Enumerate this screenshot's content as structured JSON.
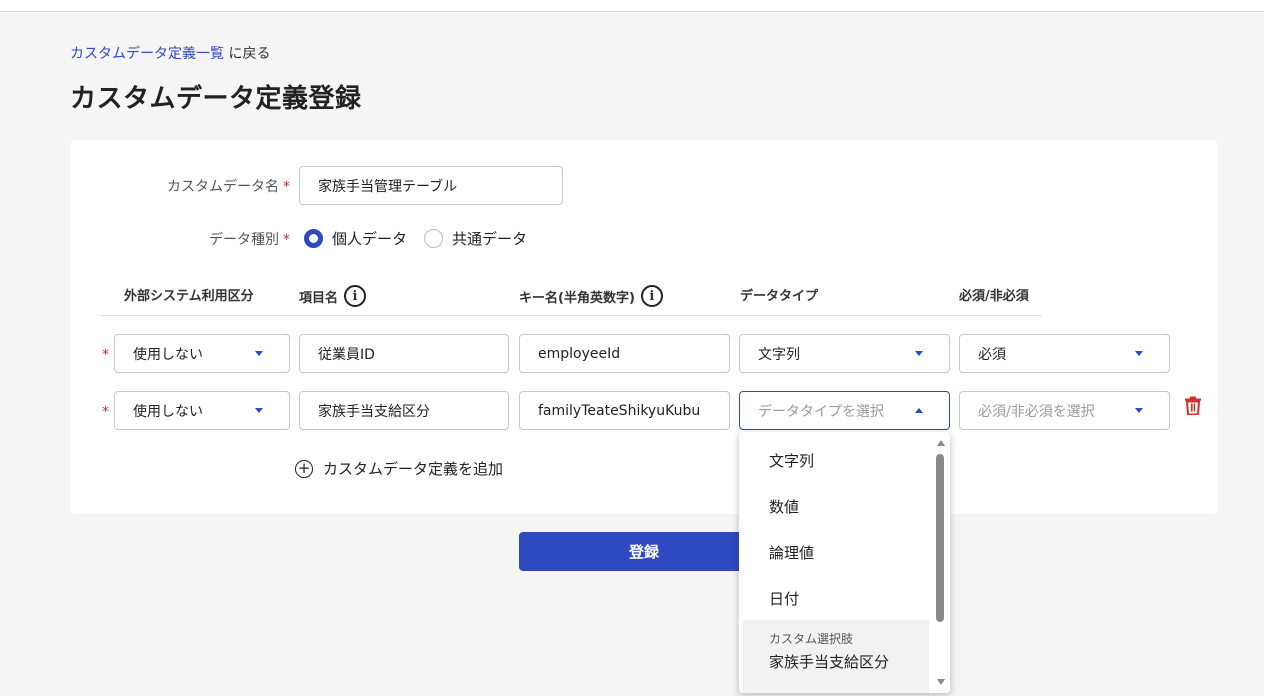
{
  "breadcrumb": {
    "link": "カスタムデータ定義一覧",
    "rest": " に戻る"
  },
  "page_title": "カスタムデータ定義登録",
  "form": {
    "name_label": "カスタムデータ名",
    "name_value": "家族手当管理テーブル",
    "type_label": "データ種別",
    "required_mark": "*",
    "radio_personal": "個人データ",
    "radio_shared": "共通データ",
    "radio_selected": "personal"
  },
  "columns": {
    "external": "外部システム利用区分",
    "item_name": "項目名",
    "key_name": "キー名(半角英数字)",
    "data_type": "データタイプ",
    "required": "必須/非必須",
    "info_glyph": "i"
  },
  "rows": [
    {
      "req": "*",
      "external": "使用しない",
      "item_name": "従業員ID",
      "key": "employeeId",
      "data_type": "文字列",
      "required": "必須"
    },
    {
      "req": "*",
      "external": "使用しない",
      "item_name": "家族手当支給区分",
      "key": "familyTeateShikyuKubu",
      "data_type": "データタイプを選択",
      "required": "必須/非必須を選択"
    }
  ],
  "add_label": "カスタムデータ定義を追加",
  "add_glyph": "+",
  "submit_label": "登録",
  "dropdown": {
    "options": [
      "文字列",
      "数値",
      "論理値",
      "日付"
    ],
    "group_label": "カスタム選択肢",
    "group_item": "家族手当支給区分"
  },
  "colors": {
    "accent": "#2f49c0",
    "required": "#d32f2f",
    "danger": "#d32f2f"
  },
  "icons": {
    "info": "info-icon",
    "trash": "trash-icon",
    "add": "plus-circle-icon",
    "caret": "caret-down-icon"
  }
}
